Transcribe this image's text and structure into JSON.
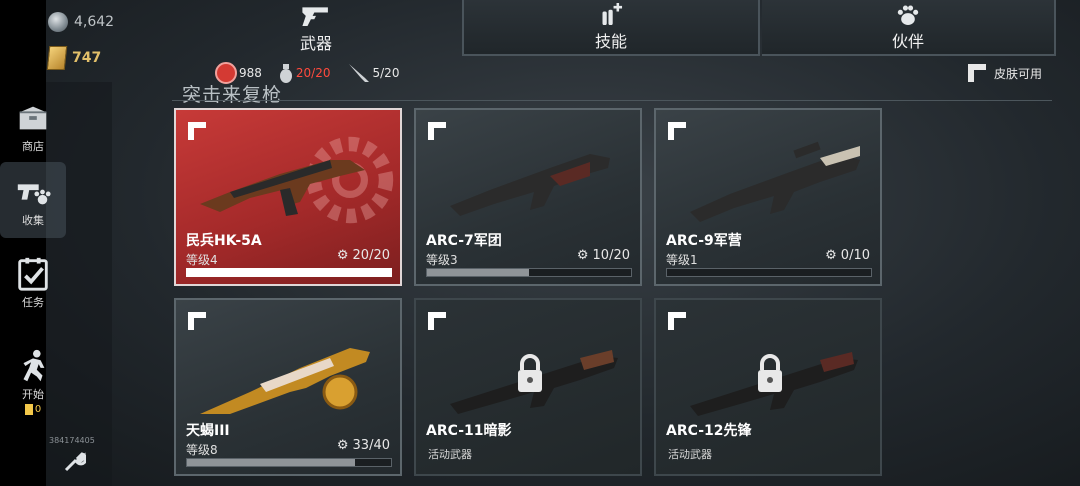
{
  "currency": {
    "coins": "4,642",
    "gold": "747"
  },
  "sidebar": {
    "items": [
      {
        "label": "商店",
        "icon": "crate-icon"
      },
      {
        "label": "收集",
        "icon": "gun-paw-icon"
      },
      {
        "label": "任务",
        "icon": "checklist-icon"
      },
      {
        "label": "开始",
        "icon": "running-man-icon",
        "sub": "0"
      }
    ],
    "player_id": "384174405"
  },
  "tabs": [
    {
      "label": "武器",
      "icon": "revolver-icon"
    },
    {
      "label": "技能",
      "icon": "bullets-plus-icon"
    },
    {
      "label": "伙伴",
      "icon": "paw-icon"
    }
  ],
  "stats": {
    "tokens": "988",
    "grenades": "20/20",
    "melee": "5/20"
  },
  "section_title": "突击来复枪",
  "skin_available": "皮肤可用",
  "cards": [
    {
      "name": "民兵HK-5A",
      "level": "等级4",
      "progress": "20/20",
      "fill": 1.0,
      "state": "selected"
    },
    {
      "name": "ARC-7军团",
      "level": "等级3",
      "progress": "10/20",
      "fill": 0.5,
      "state": "normal"
    },
    {
      "name": "ARC-9军营",
      "level": "等级1",
      "progress": "0/10",
      "fill": 0.0,
      "state": "normal"
    },
    {
      "name": "天蝎III",
      "level": "等级8",
      "progress": "33/40",
      "fill": 0.825,
      "state": "normal"
    },
    {
      "name": "ARC-11暗影",
      "status": "活动武器",
      "state": "locked"
    },
    {
      "name": "ARC-12先锋",
      "status": "活动武器",
      "state": "locked"
    }
  ],
  "colors": {
    "selected_red": "#b8302f",
    "alert_red": "#ff4a3d",
    "gold": "#e3c06a"
  }
}
